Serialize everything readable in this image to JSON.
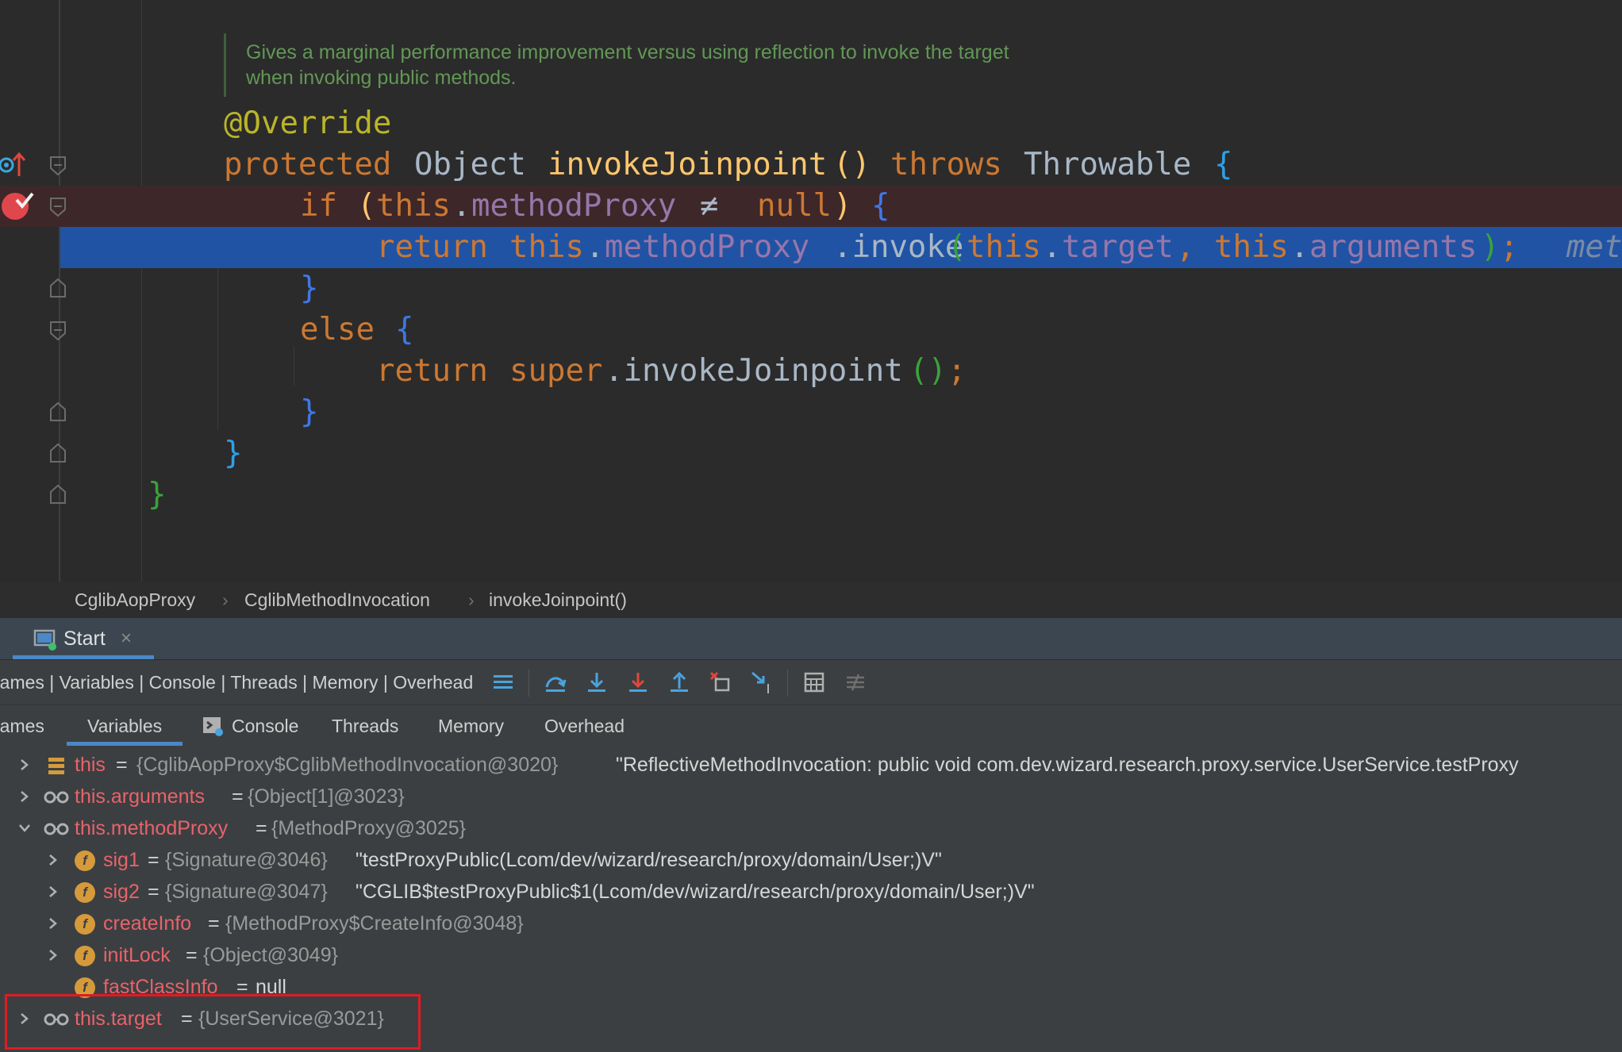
{
  "editor": {
    "doc_comment": [
      "Gives a marginal performance improvement versus using reflection to invoke the target",
      "when invoking public methods."
    ],
    "lines": {
      "annotation": "@Override",
      "sig_protected": "protected",
      "sig_object": "Object",
      "sig_method": "invokeJoinpoint",
      "sig_parens": "()",
      "sig_throws": "throws",
      "sig_throwable": "Throwable",
      "sig_brace": "{",
      "if_kw": "if",
      "if_open": "(",
      "if_this": "this",
      "if_dot": ".",
      "if_field": "methodProxy",
      "if_ne": "≠",
      "if_null": "null",
      "if_close": ")",
      "if_brace": "{",
      "ret_kw": "return",
      "ret_this": "this",
      "ret_dot1": ".",
      "ret_field": "methodProxy",
      "ret_invoke": ".invoke",
      "ret_open": "(",
      "ret_this2": "this",
      "ret_dot2": ".",
      "ret_target": "target",
      "ret_comma": ",",
      "ret_this3": "this",
      "ret_dot3": ".",
      "ret_args": "arguments",
      "ret_close": ")",
      "ret_semi": ";",
      "ret_inlay": "met",
      "close_if": "}",
      "else_kw": "else",
      "else_brace": "{",
      "ret2_kw": "return",
      "ret2_super": "super",
      "ret2_call": ".invokeJoinpoint",
      "ret2_parens": "()",
      "ret2_semi": ";",
      "close_else": "}",
      "close_method": "}",
      "close_class": "}"
    }
  },
  "breadcrumb": [
    "CglibAopProxy",
    "CglibMethodInvocation",
    "invokeJoinpoint()"
  ],
  "debug": {
    "session_tab": "Start",
    "layout_label": "rames | Variables | Console | Threads | Memory | Overhead",
    "subtabs": [
      "rames",
      "Variables",
      "Console",
      "Threads",
      "Memory",
      "Overhead"
    ],
    "active_subtab": "Variables",
    "variables": [
      {
        "name": "this",
        "eq": "=",
        "type": "{CglibAopProxy$CglibMethodInvocation@3020}",
        "value": "\"ReflectiveMethodInvocation: public void com.dev.wizard.research.proxy.service.UserService.testProxy",
        "icon": "stack-icon",
        "expanded": false
      },
      {
        "name": "this.arguments",
        "eq": "=",
        "type": "{Object[1]@3023}",
        "value": "",
        "icon": "watch-icon",
        "expanded": false
      },
      {
        "name": "this.methodProxy",
        "eq": "=",
        "type": "{MethodProxy@3025}",
        "value": "",
        "icon": "watch-icon",
        "expanded": true
      },
      {
        "name": "sig1",
        "eq": "=",
        "type": "{Signature@3046}",
        "value": "\"testProxyPublic(Lcom/dev/wizard/research/proxy/domain/User;)V\"",
        "icon": "field-icon",
        "expanded": false
      },
      {
        "name": "sig2",
        "eq": "=",
        "type": "{Signature@3047}",
        "value": "\"CGLIB$testProxyPublic$1(Lcom/dev/wizard/research/proxy/domain/User;)V\"",
        "icon": "field-icon",
        "expanded": false
      },
      {
        "name": "createInfo",
        "eq": "=",
        "type": "{MethodProxy$CreateInfo@3048}",
        "value": "",
        "icon": "field-icon",
        "expanded": false
      },
      {
        "name": "initLock",
        "eq": "=",
        "type": "{Object@3049}",
        "value": "",
        "icon": "field-icon",
        "expanded": false
      },
      {
        "name": "fastClassInfo",
        "eq": "=",
        "type": "",
        "value": "null",
        "icon": "field-icon",
        "expanded": false
      },
      {
        "name": "this.target",
        "eq": "=",
        "type": "{UserService@3021}",
        "value": "",
        "icon": "watch-icon",
        "expanded": false
      }
    ],
    "field_icon_letter": "f"
  },
  "colors": {
    "highlight_box": "#e01b24",
    "current_line": "#2053a4",
    "breakpoint_line": "#3d2729"
  }
}
